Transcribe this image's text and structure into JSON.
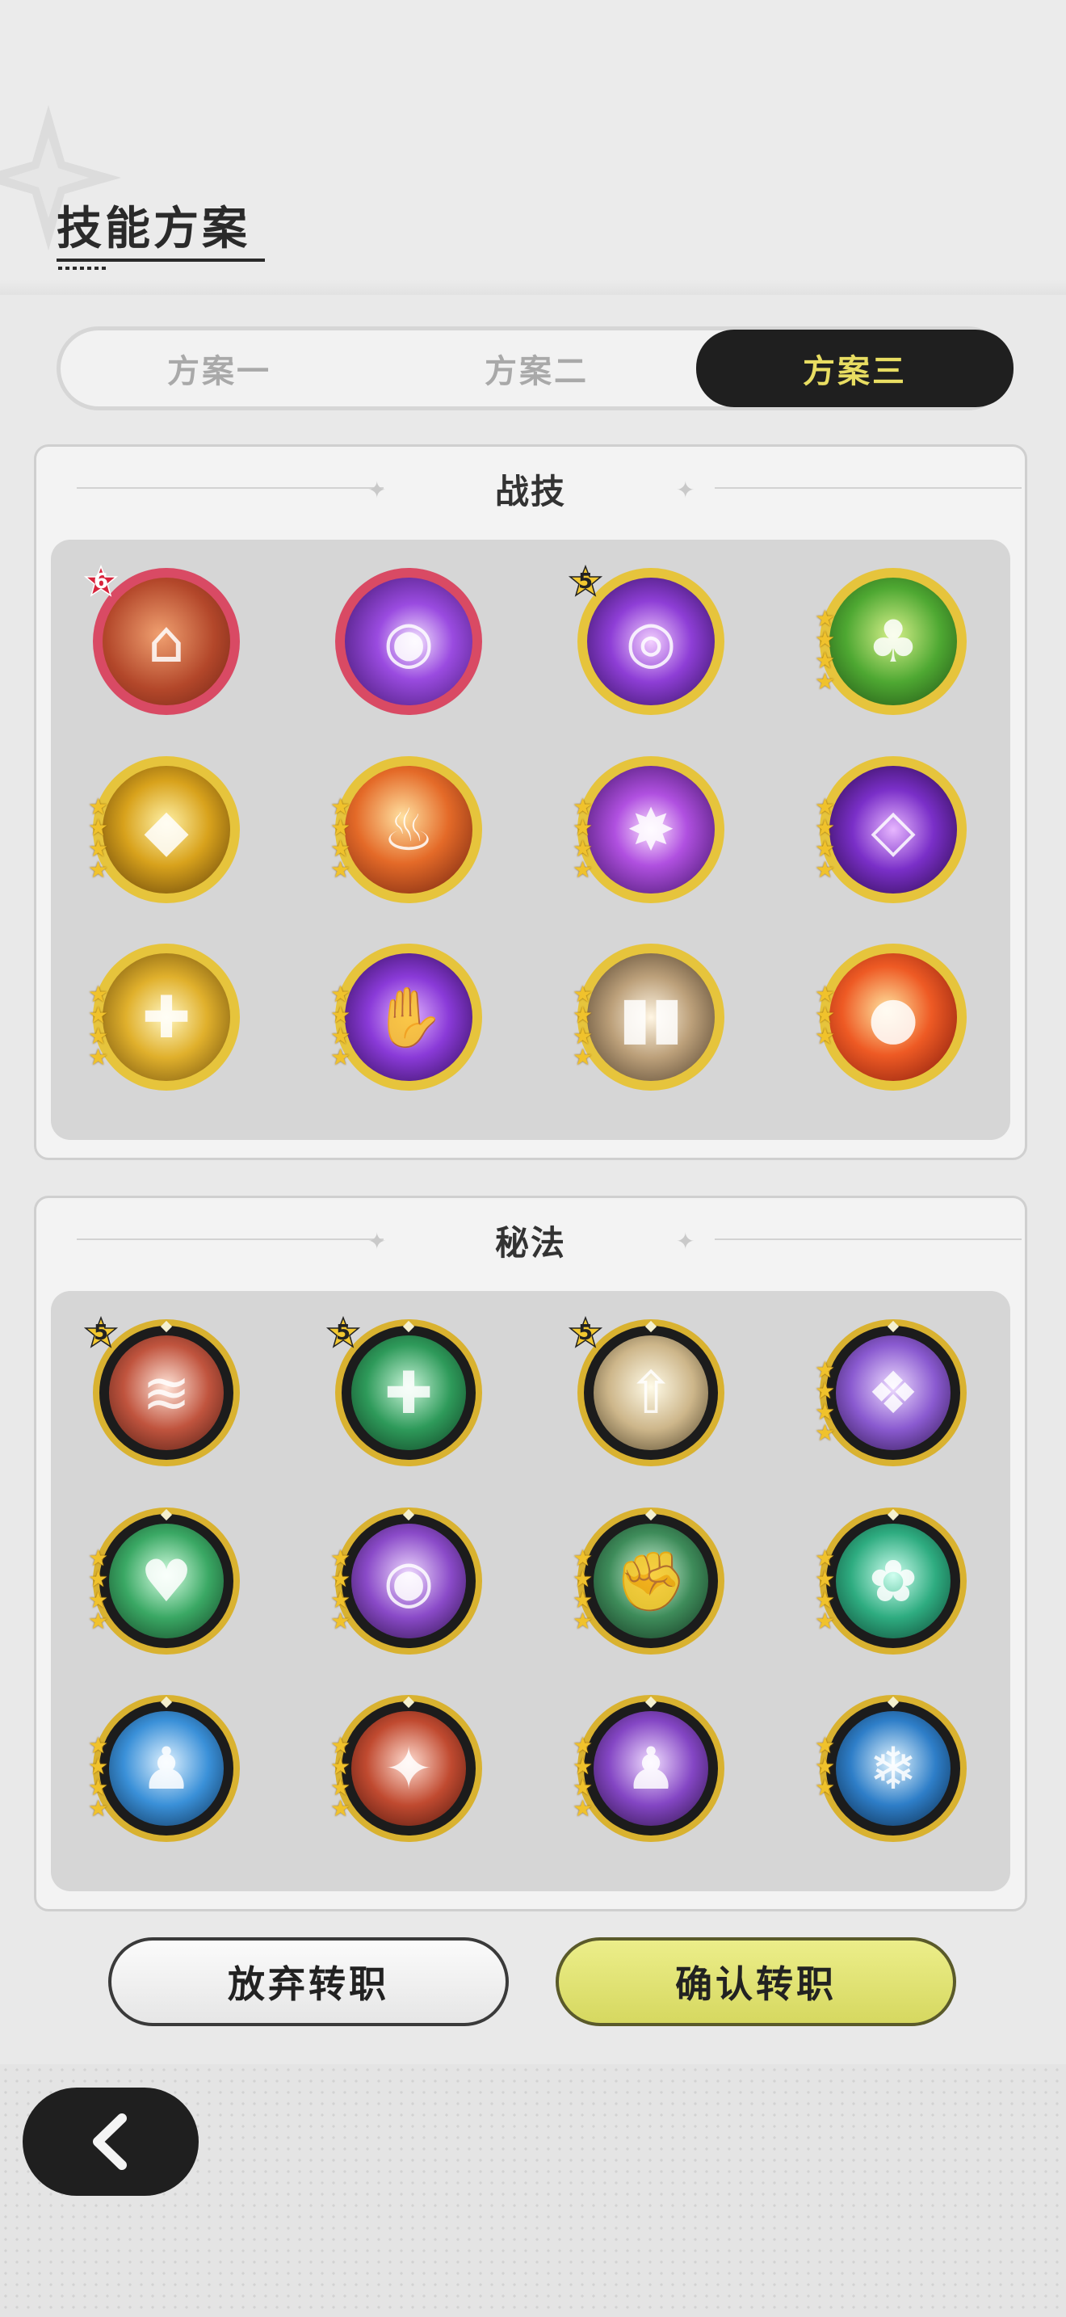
{
  "header": {
    "title": "技能方案"
  },
  "tabs": [
    {
      "label": "方案一",
      "active": false
    },
    {
      "label": "方案二",
      "active": false
    },
    {
      "label": "方案三",
      "active": true
    }
  ],
  "combat_section": {
    "title": "战技",
    "skills": [
      {
        "icon": "statue-fire-icon",
        "badge": "6",
        "badge_style": "red",
        "stars": 0,
        "frame": "red"
      },
      {
        "icon": "purple-orb-icon",
        "badge": "",
        "stars": 0,
        "frame": "red"
      },
      {
        "icon": "eye-vortex-icon",
        "badge": "5",
        "badge_style": "gold",
        "stars": 0,
        "frame": "gold"
      },
      {
        "icon": "tree-stump-icon",
        "badge": "",
        "stars": 4,
        "frame": "gold"
      },
      {
        "icon": "gold-crystal-icon",
        "badge": "",
        "stars": 4,
        "frame": "gold"
      },
      {
        "icon": "flame-wolf-icon",
        "badge": "",
        "stars": 4,
        "frame": "gold"
      },
      {
        "icon": "violet-burst-icon",
        "badge": "",
        "stars": 4,
        "frame": "gold"
      },
      {
        "icon": "purple-diamond-icon",
        "badge": "",
        "stars": 4,
        "frame": "gold"
      },
      {
        "icon": "golden-cross-icon",
        "badge": "",
        "stars": 4,
        "frame": "gold"
      },
      {
        "icon": "purple-hand-icon",
        "badge": "",
        "stars": 4,
        "frame": "gold"
      },
      {
        "icon": "cards-icon",
        "badge": "",
        "stars": 4,
        "frame": "gold"
      },
      {
        "icon": "fireball-icon",
        "badge": "",
        "stars": 3,
        "frame": "gold"
      }
    ]
  },
  "secret_section": {
    "title": "秘法",
    "skills": [
      {
        "icon": "red-wave-icon",
        "badge": "5",
        "stars": 0
      },
      {
        "icon": "green-cross-icon",
        "badge": "5",
        "stars": 0
      },
      {
        "icon": "arrow-up-icon",
        "badge": "5",
        "stars": 0
      },
      {
        "icon": "purple-pouch-icon",
        "badge": "",
        "stars": 4
      },
      {
        "icon": "green-heart-icon",
        "badge": "",
        "stars": 4
      },
      {
        "icon": "purple-eye-icon",
        "badge": "",
        "stars": 4
      },
      {
        "icon": "green-rock-icon",
        "badge": "",
        "stars": 4
      },
      {
        "icon": "green-gem-icon",
        "badge": "",
        "stars": 4
      },
      {
        "icon": "blue-figure-icon",
        "badge": "",
        "stars": 4
      },
      {
        "icon": "red-shards-icon",
        "badge": "",
        "stars": 4
      },
      {
        "icon": "purple-figure-icon",
        "badge": "",
        "stars": 4
      },
      {
        "icon": "ice-wing-icon",
        "badge": "",
        "stars": 3
      }
    ]
  },
  "actions": {
    "abandon_label": "放弃转职",
    "confirm_label": "确认转职"
  },
  "nav": {
    "back_icon": "chevron-left-icon"
  },
  "colors": {
    "accent_yellow": "#e8dd62",
    "dark": "#1f1f1f",
    "gold_frame": "#d9b230",
    "red_frame": "#d94a64"
  }
}
